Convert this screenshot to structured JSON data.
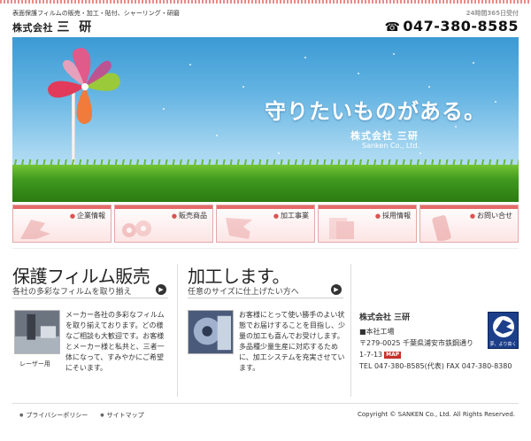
{
  "header": {
    "tagline": "表面保護フィルムの販売・加工・貼付、シャーリング・研磨",
    "logo_prefix": "株式会社",
    "logo_name": "三 研",
    "hours": "24時間365日受付",
    "phone": "047-380-8585"
  },
  "hero": {
    "title": "守りたいものがある。",
    "company": "株式会社 三研",
    "company_en": "Sanken Co., Ltd."
  },
  "nav": [
    {
      "label": "企業情報"
    },
    {
      "label": "販売商品"
    },
    {
      "label": "加工事業"
    },
    {
      "label": "採用情報"
    },
    {
      "label": "お問い合せ"
    }
  ],
  "sales": {
    "title": "保護フィルム販売",
    "subtitle": "各社の多彩なフィルムを取り揃え",
    "image_caption": "レーザー用",
    "text": "メーカー各社の多彩なフィルムを取り揃えております。どの様なご相談も大歓迎です。お客様とメーカー様と私共と、三者一体になって、すみやかにご希望にそいます。"
  },
  "processing": {
    "title": "加工します。",
    "subtitle": "任意のサイズに仕上げたい方へ",
    "text": "お客様にとって使い勝手のよい状態でお届けすることを目指し、少量の加工も喜んでお受けします。多品種少量生産に対応するために、加工システムを充実させています。"
  },
  "company": {
    "name": "株式会社 三研",
    "factory": "■本社工場",
    "address1": "〒279-0025 千葉県浦安市鉄鋼通り",
    "address2": "1-7-13",
    "map_label": "MAP",
    "contact": "TEL 047-380-8585(代表) FAX 047-380-8380",
    "emblem_text": "夢、より高く"
  },
  "footer": {
    "privacy": "プライバシーポリシー",
    "sitemap": "サイトマップ",
    "copyright": "Copyright © SANKEN Co., Ltd.  All Rights Reserved."
  },
  "colors": {
    "accent": "#e46a6a",
    "sky": "#3b9ad4",
    "grass": "#3f9a1e"
  }
}
